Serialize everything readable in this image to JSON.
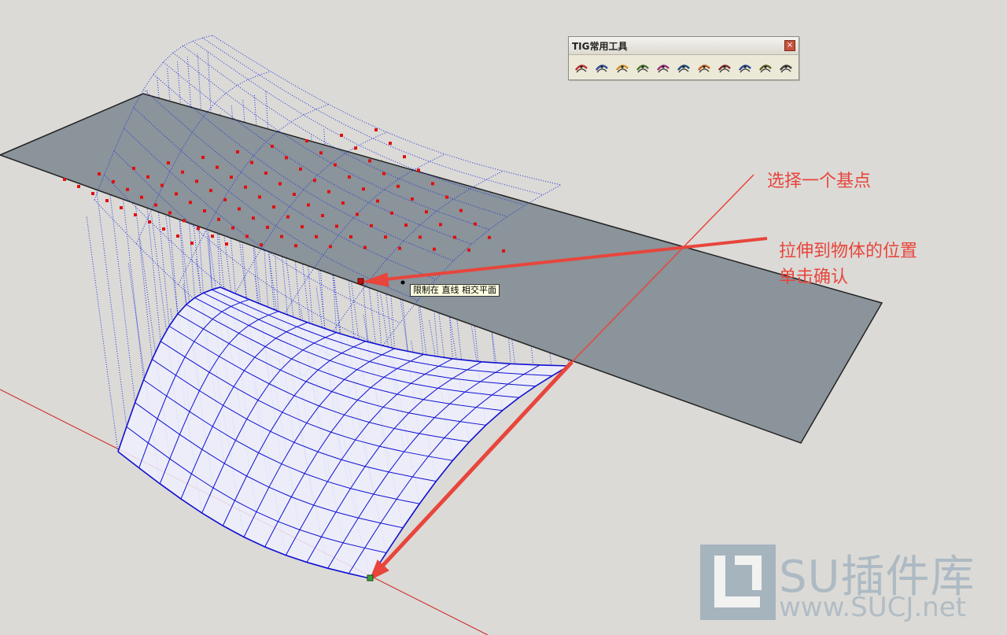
{
  "toolbar": {
    "title": "TIG常用工具",
    "close_label": "×",
    "tools": [
      {
        "name": "tool-1-icon"
      },
      {
        "name": "tool-2-icon"
      },
      {
        "name": "tool-3-icon"
      },
      {
        "name": "tool-4-icon"
      },
      {
        "name": "tool-5-icon"
      },
      {
        "name": "tool-6-icon"
      },
      {
        "name": "tool-7-icon"
      },
      {
        "name": "tool-8-icon"
      },
      {
        "name": "tool-9-icon"
      },
      {
        "name": "tool-10-icon"
      },
      {
        "name": "tool-11-icon"
      }
    ]
  },
  "tooltip": {
    "text": "限制在 直线 相交平面"
  },
  "annotations": {
    "select_base": "选择一个基点",
    "stretch": "拉伸到物体的位置",
    "confirm": "单击确认"
  },
  "watermark": {
    "brand": "SU插件库",
    "url": "www.SUCJ.net"
  },
  "colors": {
    "background": "#dbdad6",
    "plane": "#8a949a",
    "mesh": "#1010d0",
    "annotation": "#e8453c",
    "points": "#e01010"
  }
}
